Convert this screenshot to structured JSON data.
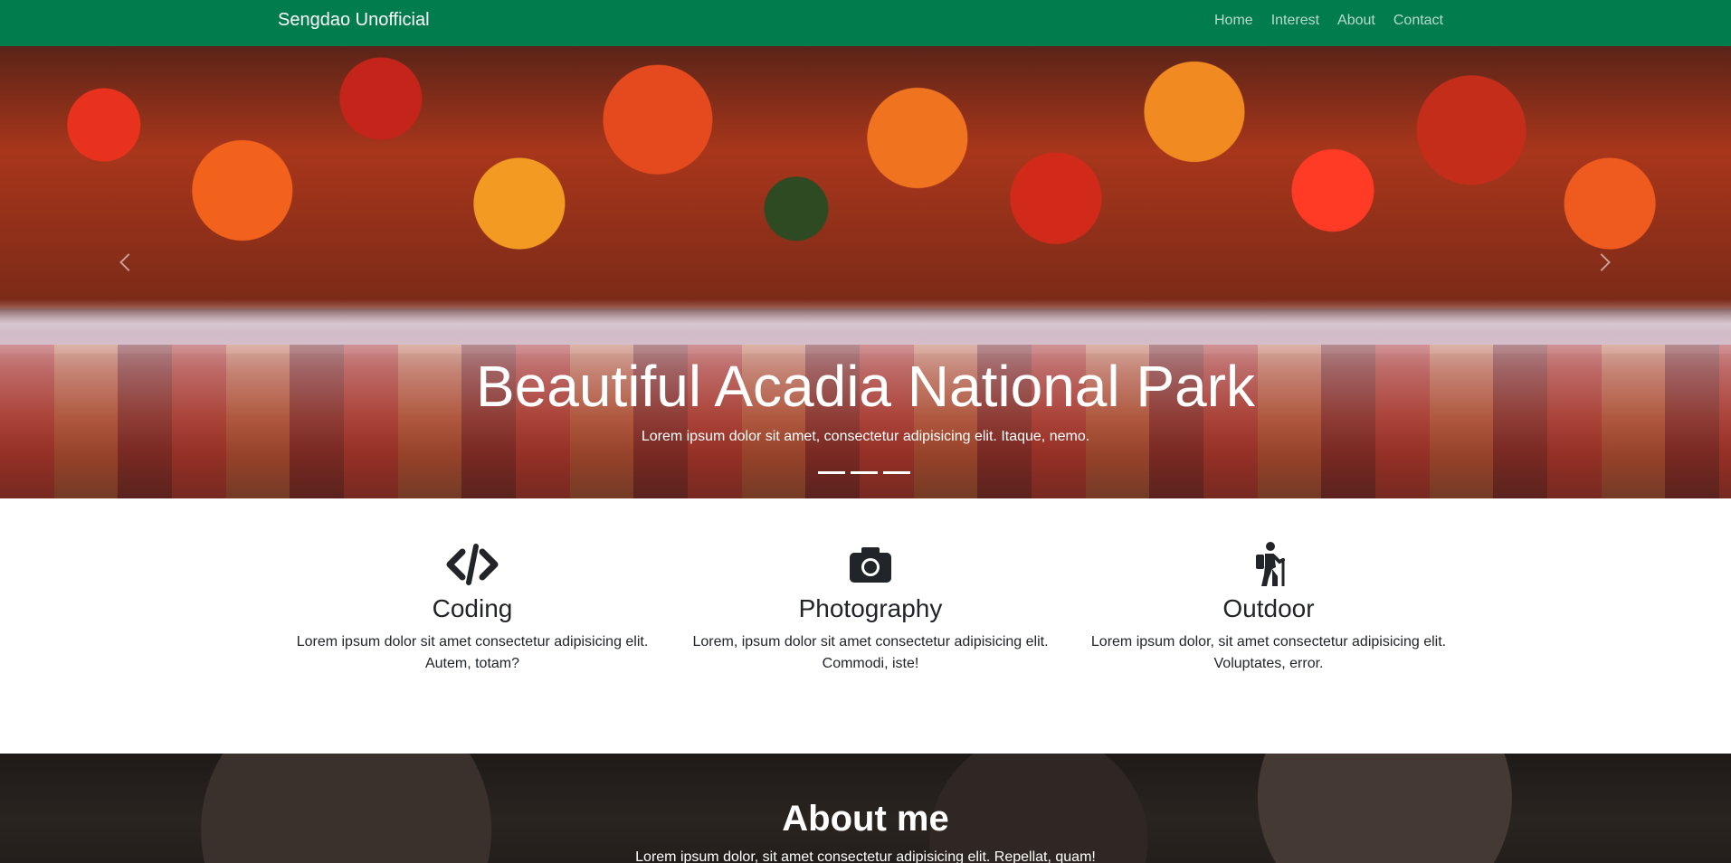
{
  "navbar": {
    "brand": "Sengdao Unofficial",
    "links": [
      "Home",
      "Interest",
      "About",
      "Contact"
    ]
  },
  "hero": {
    "title": "Beautiful Acadia National Park",
    "text": "Lorem ipsum dolor sit amet, consectetur adipisicing elit. Itaque, nemo.",
    "slide_count": 3
  },
  "features": [
    {
      "icon": "code-icon",
      "title": "Coding",
      "text_line1": "Lorem ipsum dolor sit amet consectetur adipisicing elit.",
      "text_line2": "Autem, totam?"
    },
    {
      "icon": "camera-icon",
      "title": "Photography",
      "text_line1": "Lorem, ipsum dolor sit amet consectetur adipisicing elit.",
      "text_line2": "Commodi, iste!"
    },
    {
      "icon": "hiking-icon",
      "title": "Outdoor",
      "text_line1": "Lorem ipsum dolor, sit amet consectetur adipisicing elit.",
      "text_line2": "Voluptates, error."
    }
  ],
  "about": {
    "title": "About me",
    "text": "Lorem ipsum dolor, sit amet consectetur adipisicing elit. Repellat, quam!"
  },
  "colors": {
    "navbar_bg": "#017c4c"
  }
}
